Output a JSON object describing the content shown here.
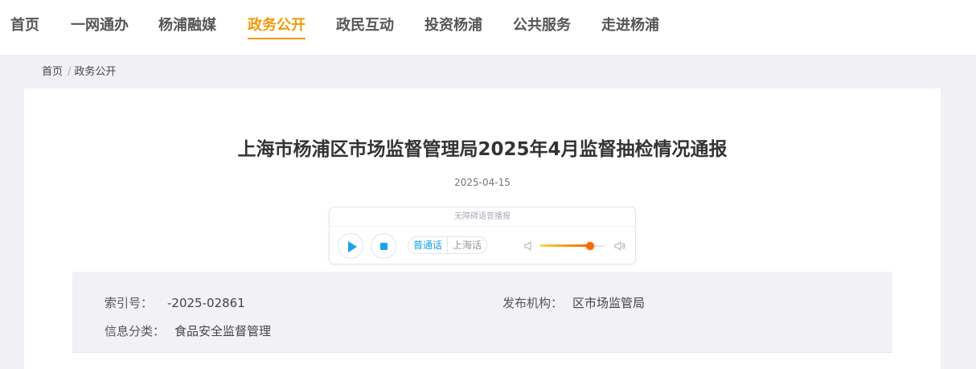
{
  "nav": {
    "items": [
      {
        "label": "首页"
      },
      {
        "label": "一网通办"
      },
      {
        "label": "杨浦融媒"
      },
      {
        "label": "政务公开"
      },
      {
        "label": "政民互动"
      },
      {
        "label": "投资杨浦"
      },
      {
        "label": "公共服务"
      },
      {
        "label": "走进杨浦"
      }
    ],
    "active_label": "政务公开",
    "active_color": "#f09a0c"
  },
  "breadcrumb": {
    "home": "首页",
    "separator": "/",
    "current": "政务公开"
  },
  "article": {
    "title": "上海市杨浦区市场监督管理局2025年4月监督抽检情况通报",
    "date": "2025-04-15"
  },
  "player": {
    "header": "无障碍语音播报",
    "lang_mandarin": "普通话",
    "lang_shanghai": "上海话",
    "selected_lang": "普通话",
    "volume_percent": 78,
    "accent_color": "#1aa3e8"
  },
  "meta": {
    "index_label": "索引号：",
    "index_value": "-2025-02861",
    "publisher_label": "发布机构：",
    "publisher_value": "区市场监管局",
    "category_label": "信息分类：",
    "category_value": "食品安全监督管理"
  }
}
